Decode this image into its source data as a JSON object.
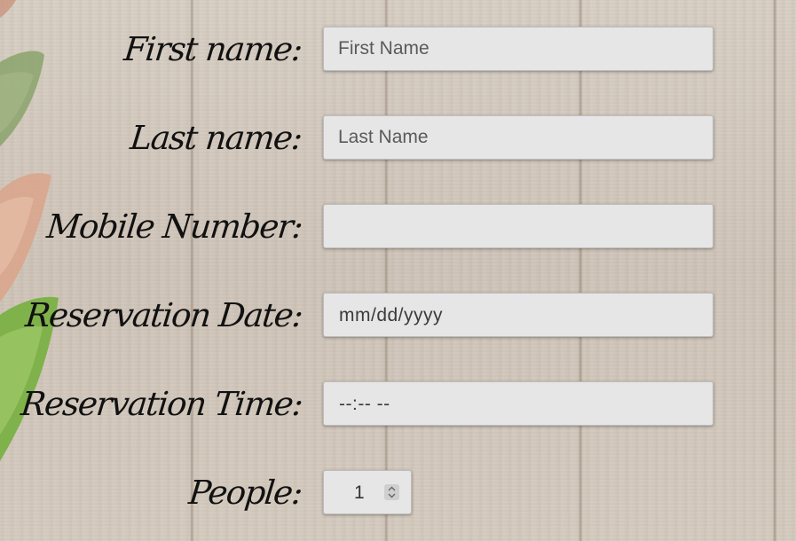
{
  "form": {
    "first_name": {
      "label": "First name:",
      "placeholder": "First Name",
      "value": ""
    },
    "last_name": {
      "label": "Last name:",
      "placeholder": "Last Name",
      "value": ""
    },
    "mobile_number": {
      "label": "Mobile Number:",
      "placeholder": "",
      "value": ""
    },
    "reservation_date": {
      "label": "Reservation Date:",
      "display": "mm/dd/yyyy"
    },
    "reservation_time": {
      "label": "Reservation Time:",
      "display": "--:-- --"
    },
    "people": {
      "label": "People:",
      "value": "1"
    }
  },
  "icons": {
    "spinner": "updown-spinner-icon",
    "background_decoration": "leaves-decoration"
  },
  "colors": {
    "field_background": "#e6e6e6",
    "label_text": "#111111",
    "placeholder_text": "#5a5a5a"
  }
}
